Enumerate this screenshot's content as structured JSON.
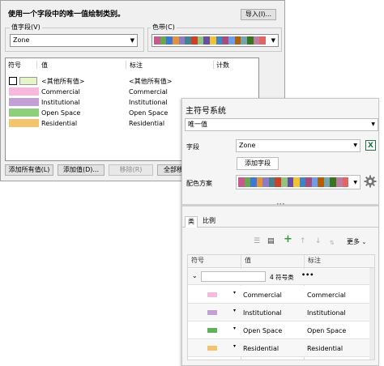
{
  "old_dialog": {
    "description": "使用一个字段中的唯一值绘制类别。",
    "import_button": "导入(I)...",
    "value_field_label": "值字段(V)",
    "value_field_value": "Zone",
    "color_ramp_label": "色带(C)",
    "columns": [
      "符号",
      "值",
      "标注",
      "计数"
    ],
    "rows": [
      {
        "value": "<其他所有值>",
        "label": "<其他所有值>",
        "color": "#e6f5c9",
        "outlined": true
      },
      {
        "value": "Commercial",
        "label": "Commercial",
        "color": "#f6b9dd"
      },
      {
        "value": "Institutional",
        "label": "Institutional",
        "color": "#c4a0d8"
      },
      {
        "value": "Open Space",
        "label": "Open Space",
        "color": "#8ecf7d"
      },
      {
        "value": "Residential",
        "label": "Residential",
        "color": "#f4c46c"
      }
    ],
    "buttons": {
      "add_all": "添加所有值(L)",
      "add_values": "添加值(D)...",
      "remove": "移除(R)",
      "remove_all": "全部移"
    }
  },
  "pane": {
    "title": "主符号系统",
    "renderer": "唯一值",
    "field_label": "字段",
    "field_value": "Zone",
    "add_field": "添加字段",
    "color_scheme_label": "配色方案",
    "tabs": [
      "类",
      "比例"
    ],
    "more": "更多",
    "columns": [
      "符号",
      "值",
      "标注"
    ],
    "group_text": "4 符号类",
    "group_dots": "•••",
    "rows": [
      {
        "value": "Commercial",
        "label": "Commercial",
        "color": "#f6b9dd"
      },
      {
        "value": "Institutional",
        "label": "Institutional",
        "color": "#c4a0d8"
      },
      {
        "value": "Open Space",
        "label": "Open Space",
        "color": "#5fb15a"
      },
      {
        "value": "Residential",
        "label": "Residential",
        "color": "#f4c46c"
      }
    ]
  },
  "ramp_colors": [
    "#c65a8c",
    "#6aa84f",
    "#3c78d8",
    "#e69138",
    "#8e7cc3",
    "#45818e",
    "#cc4125",
    "#93c47d",
    "#674ea7",
    "#f1c232",
    "#3d85c6",
    "#a64d79",
    "#6d9eeb",
    "#b45f06",
    "#76a5af",
    "#38761d",
    "#c27ba0",
    "#e06666"
  ],
  "icons": {
    "excel": "excel-icon",
    "settings": "gear-icon",
    "add": "plus-icon",
    "up": "arrow-up-icon",
    "down": "arrow-down-icon"
  }
}
